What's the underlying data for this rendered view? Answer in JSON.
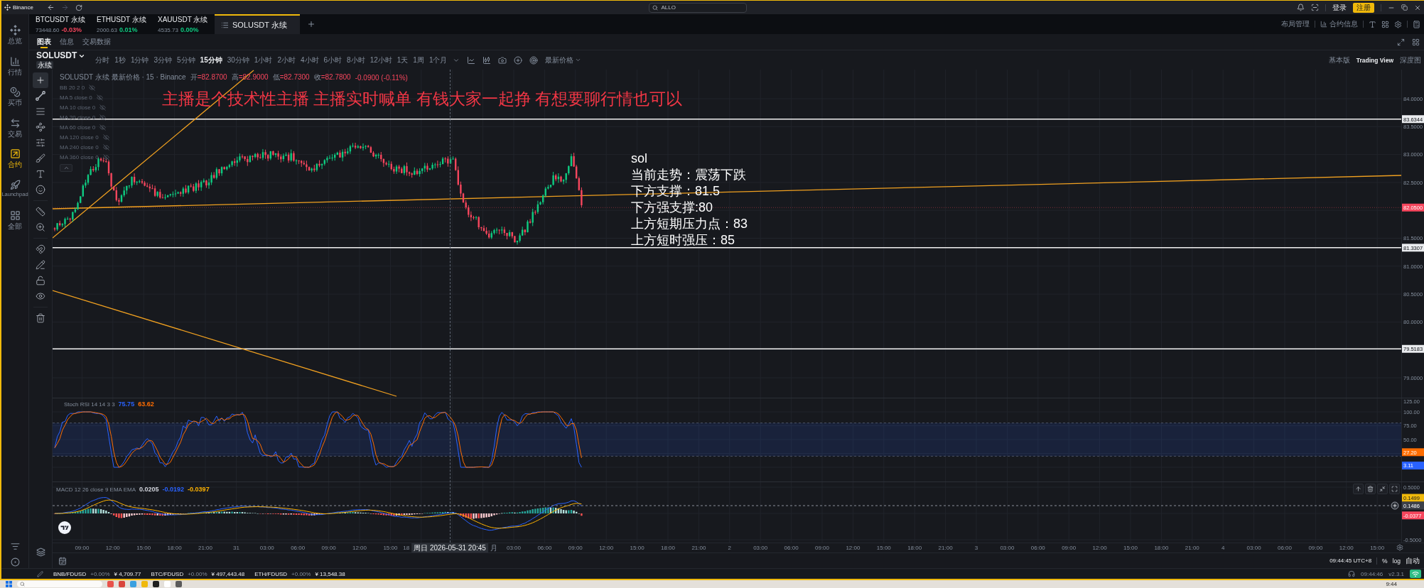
{
  "title_bar": {
    "app_name": "Binance",
    "search": {
      "placeholder": "ALLO"
    },
    "login": "登录",
    "register": "注册"
  },
  "sidebar": {
    "items": [
      {
        "label": "总览",
        "selected": false
      },
      {
        "label": "行情",
        "selected": false
      },
      {
        "label": "买币",
        "selected": false
      },
      {
        "label": "交易",
        "selected": false
      },
      {
        "label": "合约",
        "selected": true
      },
      {
        "label": "Launchpad",
        "selected": false
      },
      {
        "label": "全部",
        "selected": false
      }
    ]
  },
  "tabs": [
    {
      "symbol": "BTCUSDT 永续",
      "price": "73448.60",
      "change": "-0.03%",
      "color": "#f6465d",
      "selected": false
    },
    {
      "symbol": "ETHUSDT 永续",
      "price": "2000.63",
      "change": "0.01%",
      "color": "#0ecb81",
      "selected": false
    },
    {
      "symbol": "XAUUSDT 永续",
      "price": "4535.73",
      "change": "0.00%",
      "color": "#0ecb81",
      "selected": false
    },
    {
      "symbol": "SOLUSDT 永续",
      "selected": true
    }
  ],
  "tab_tools": {
    "layout": "布局管理",
    "contract_info": "合约信息"
  },
  "sub_tabs": [
    {
      "label": "图表",
      "selected": true
    },
    {
      "label": "信息",
      "selected": false
    },
    {
      "label": "交易数据",
      "selected": false
    }
  ],
  "chart_toolbar": {
    "symbol": "SOLUSDT",
    "contract": "永续",
    "intervals": [
      {
        "label": "分时",
        "selected": false
      },
      {
        "label": "1秒",
        "selected": false
      },
      {
        "label": "1分钟",
        "selected": false
      },
      {
        "label": "3分钟",
        "selected": false
      },
      {
        "label": "5分钟",
        "selected": false
      },
      {
        "label": "15分钟",
        "selected": true
      },
      {
        "label": "30分钟",
        "selected": false
      },
      {
        "label": "1小时",
        "selected": false
      },
      {
        "label": "2小时",
        "selected": false
      },
      {
        "label": "4小时",
        "selected": false
      },
      {
        "label": "6小时",
        "selected": false
      },
      {
        "label": "8小时",
        "selected": false
      },
      {
        "label": "12小时",
        "selected": false
      },
      {
        "label": "1天",
        "selected": false
      },
      {
        "label": "1周",
        "selected": false
      },
      {
        "label": "1个月",
        "selected": false
      }
    ],
    "price_source": "最新价格",
    "views": [
      {
        "label": "基本版",
        "selected": false
      },
      {
        "label": "Trading View",
        "selected": true
      },
      {
        "label": "深度图",
        "selected": false
      }
    ]
  },
  "drawing_tools": [
    {
      "tools": [
        {
          "kind": "crosshair",
          "selected": true
        },
        {
          "kind": "trend_line",
          "selected": false
        },
        {
          "kind": "parallel_lines",
          "selected": false
        },
        {
          "kind": "pattern",
          "selected": false
        },
        {
          "kind": "fib",
          "selected": false
        },
        {
          "kind": "brush",
          "selected": false
        },
        {
          "kind": "text",
          "selected": false
        },
        {
          "kind": "emoji",
          "selected": false
        }
      ]
    },
    {
      "tools": [
        {
          "kind": "ruler",
          "selected": false
        },
        {
          "kind": "zoom",
          "selected": false
        }
      ]
    },
    {
      "tools": [
        {
          "kind": "magnet",
          "selected": false
        },
        {
          "kind": "pencil",
          "selected": false
        },
        {
          "kind": "lock",
          "selected": false
        },
        {
          "kind": "eye",
          "selected": false
        }
      ]
    },
    {
      "tools": [
        {
          "kind": "trash",
          "selected": false
        }
      ]
    }
  ],
  "chart": {
    "legend": {
      "title": "SOLUSDT 永续 最新价格 · 15 · Binance",
      "ohlc": [
        {
          "label": "开",
          "value": "=82.8700"
        },
        {
          "label": "高",
          "value": "=82.9000"
        },
        {
          "label": "低",
          "value": "=82.7300"
        },
        {
          "label": "收",
          "value": "=82.7800"
        }
      ],
      "change": "-0.0900 (-0.11%)"
    },
    "indicators": [
      {
        "label": "BB 20 2 0",
        "visible": false
      },
      {
        "label": "MA 5 close 0",
        "visible": false
      },
      {
        "label": "MA 10 close 0",
        "visible": false
      },
      {
        "label": "MA 20 close 0",
        "visible": false
      },
      {
        "label": "MA 60 close 0",
        "visible": false
      },
      {
        "label": "MA 120 close 0",
        "visible": false
      },
      {
        "label": "MA 240 close 0",
        "visible": false
      },
      {
        "label": "MA 360 close 0",
        "visible": false
      }
    ],
    "annotation": "主播是个技术性主播 主播实时喊单 有钱大家一起挣 有想要聊行情也可以",
    "note": [
      "sol",
      "当前走势：震荡下跌",
      "下方支撑：81.5",
      "下方强支撑:80",
      "上方短期压力点：83",
      "上方短时强压：85"
    ],
    "price_axis": [
      "84.0000",
      "83.5000",
      "83.0000",
      "82.5000",
      "81.5000",
      "81.0000",
      "80.5000",
      "80.0000",
      "79.0000"
    ],
    "price_tags": [
      {
        "value": "83.6344",
        "kind": "level"
      },
      {
        "value": "82.0500",
        "kind": "last"
      },
      {
        "value": "81.3307",
        "kind": "level"
      },
      {
        "value": "79.5183",
        "kind": "level"
      }
    ]
  },
  "stoch_rsi": {
    "label": "Stoch RSI 14 14 3 3",
    "values": [
      {
        "text": "75.75",
        "color": "#2962ff"
      },
      {
        "text": "63.62",
        "color": "#ff6d00"
      }
    ],
    "axis": [
      "125.00",
      "100.00",
      "75.00",
      "50.00"
    ],
    "tags": [
      {
        "value": "27.20",
        "color": "#ff6d00"
      },
      {
        "value": "3.11",
        "color": "#2962ff"
      }
    ]
  },
  "macd": {
    "label": "MACD 12 26 close 9 EMA EMA",
    "values": [
      {
        "text": "0.0205",
        "color": "#d1d4dc"
      },
      {
        "text": "-0.0192",
        "color": "#2962ff"
      },
      {
        "text": "-0.0397",
        "color": "#ffb300"
      }
    ],
    "axis": [
      "0.5000",
      "-0.5000"
    ],
    "tags": [
      {
        "value": "0.1499",
        "kind": "signal"
      },
      {
        "value": "0.1486",
        "kind": "crosshair"
      },
      {
        "value": "-0.0377",
        "kind": "histogram"
      }
    ]
  },
  "time_axis": {
    "labels_before": [
      "09:00",
      "12:00",
      "15:00",
      "18:00",
      "21:00",
      "31",
      "03:00",
      "06:00",
      "09:00",
      "12:00",
      "15:00",
      "18"
    ],
    "cursor": "周日 2026-05-31 20:45",
    "labels_after": [
      "月",
      "03:00",
      "06:00",
      "09:00",
      "12:00",
      "15:00",
      "18:00",
      "21:00",
      "2",
      "03:00",
      "06:00",
      "09:00",
      "12:00",
      "15:00",
      "18:00",
      "21:00",
      "3",
      "03:00",
      "06:00",
      "09:00",
      "12:00",
      "15:00",
      "18:00",
      "21:00",
      "4",
      "03:00",
      "06:00",
      "09:00",
      "12:00",
      "15:00"
    ]
  },
  "bottom_bar": {
    "clock": "09:44:45 UTC+8",
    "percent": "%",
    "log": "log",
    "auto": "自动"
  },
  "status_bar": {
    "tickers": [
      {
        "pair": "BNB/FDUSD",
        "change": "+0.00%",
        "price": "¥ 4,709.77"
      },
      {
        "pair": "BTC/FDUSD",
        "change": "+0.00%",
        "price": "¥ 497,443.48"
      },
      {
        "pair": "ETH/FDUSD",
        "change": "+0.00%",
        "price": "¥ 13,548.38"
      }
    ],
    "time": "09:44:46",
    "version": "v2.3.1"
  },
  "taskbar": {
    "time": "9:44"
  }
}
